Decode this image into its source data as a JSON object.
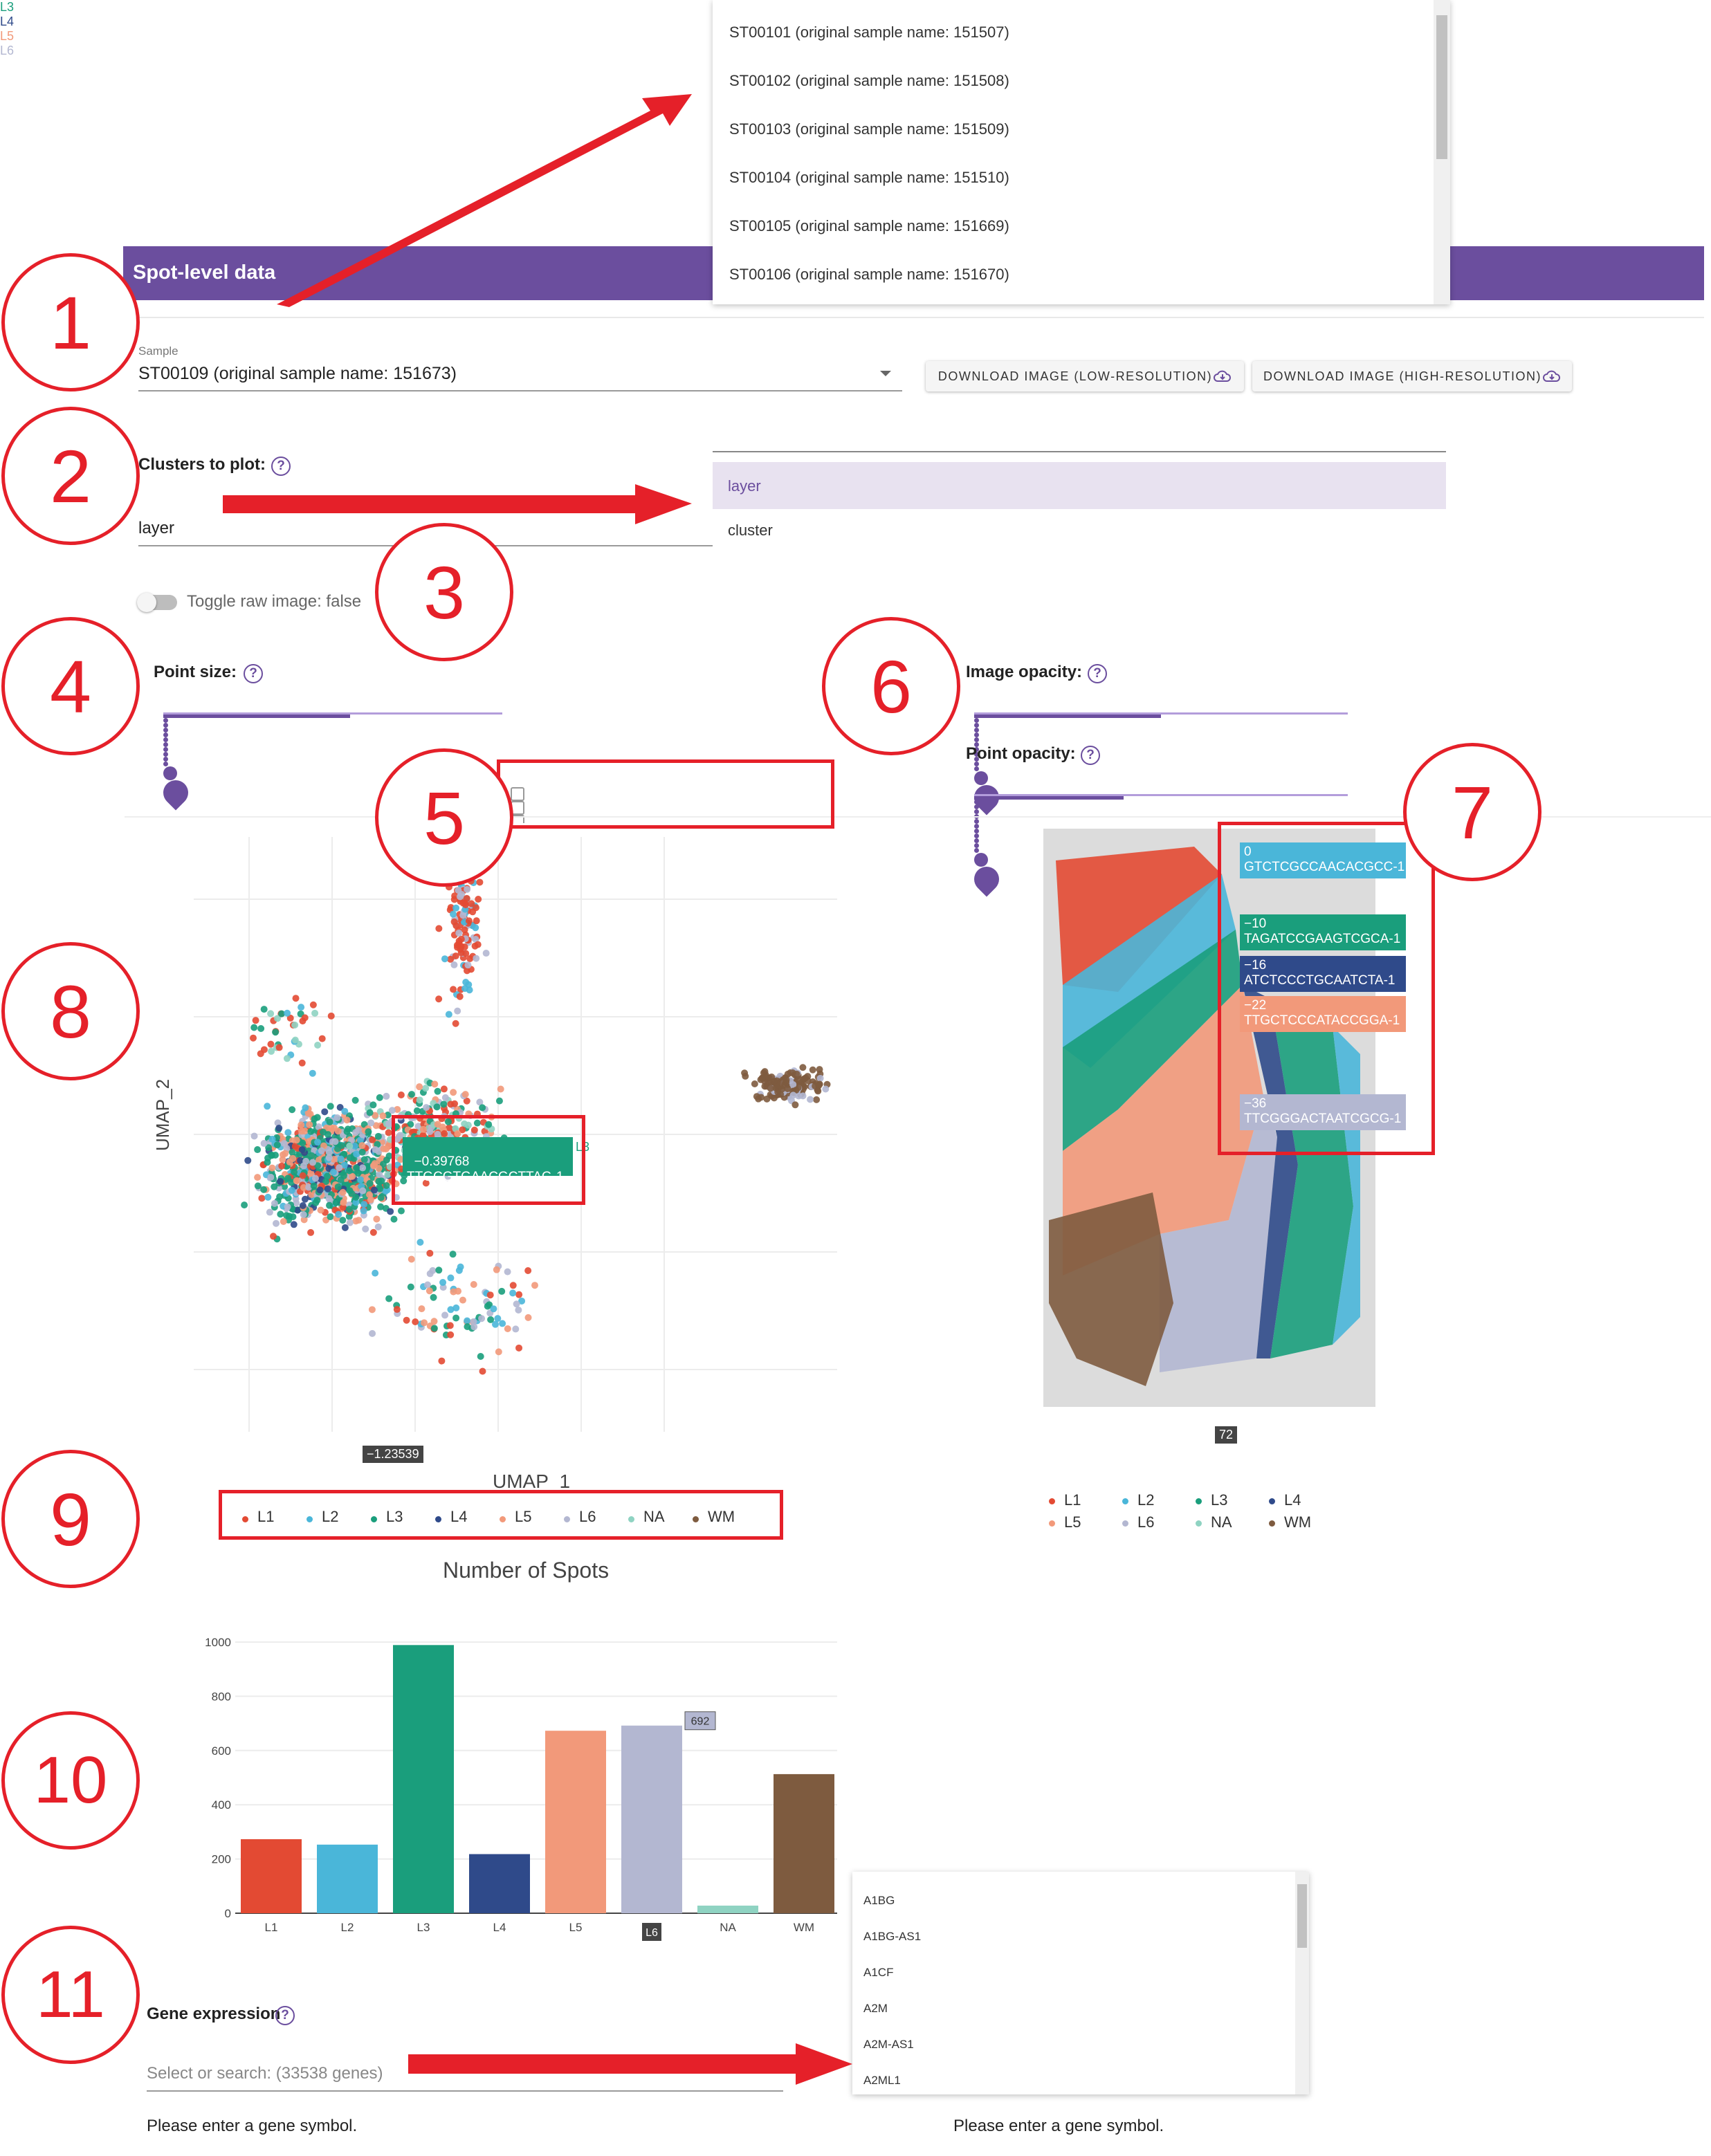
{
  "sample_dropdown": {
    "options": [
      "ST00101 (original sample name: 151507)",
      "ST00102 (original sample name: 151508)",
      "ST00103 (original sample name: 151509)",
      "ST00104 (original sample name: 151510)",
      "ST00105 (original sample name: 151669)",
      "ST00106 (original sample name: 151670)"
    ]
  },
  "header": {
    "title": "Spot-level data"
  },
  "sample": {
    "label": "Sample",
    "value": "ST00109 (original sample name: 151673)"
  },
  "buttons": {
    "download_low": "DOWNLOAD IMAGE (LOW-RESOLUTION)",
    "download_high": "DOWNLOAD IMAGE (HIGH-RESOLUTION)"
  },
  "clusters": {
    "label": "Clusters to plot:",
    "value": "layer",
    "options": [
      "layer",
      "cluster"
    ]
  },
  "toggle": {
    "label": "Toggle raw image: false"
  },
  "sliders": {
    "point_size": {
      "label": "Point size:",
      "value": 6,
      "fraction": 0.55
    },
    "image_opacity": {
      "label": "Image opacity:",
      "value": "0.5",
      "fraction": 0.5
    },
    "point_opacity": {
      "label": "Point opacity:",
      "value": "0.4",
      "fraction": 0.4
    }
  },
  "annotations": [
    "1",
    "2",
    "3",
    "4",
    "5",
    "6",
    "7",
    "8",
    "9",
    "10",
    "11"
  ],
  "umap": {
    "xlabel": "UMAP_1",
    "ylabel": "UMAP_2",
    "x_hover": "−1.23539",
    "tooltip": {
      "value": "−0.39768",
      "barcode": "TTGCGTGAACGCTTAG-1",
      "layer": "L3"
    }
  },
  "spatial": {
    "x_hover": "72",
    "tooltips": [
      {
        "value": "0",
        "barcode": "GTCTCGCCAACACGCC-1",
        "layer": "",
        "color": "#4ab6d9"
      },
      {
        "value": "−10",
        "barcode": "TAGATCCGAAGTCGCA-1",
        "layer": "L3",
        "color": "#1a9e7c"
      },
      {
        "value": "−16",
        "barcode": "ATCTCCCTGCAATCTA-1",
        "layer": "L4",
        "color": "#2f4a8a"
      },
      {
        "value": "−22",
        "barcode": "TTGCTCCCATACCGGA-1",
        "layer": "L5",
        "color": "#f2997a"
      },
      {
        "value": "−36",
        "barcode": "TTCGGGACTAATCGCG-1",
        "layer": "L6",
        "color": "#b3b7d1"
      }
    ]
  },
  "legend": [
    {
      "name": "L1",
      "color": "#e34a33"
    },
    {
      "name": "L2",
      "color": "#4ab6d9"
    },
    {
      "name": "L3",
      "color": "#1a9e7c"
    },
    {
      "name": "L4",
      "color": "#2f4a8a"
    },
    {
      "name": "L5",
      "color": "#f2997a"
    },
    {
      "name": "L6",
      "color": "#b3b7d1"
    },
    {
      "name": "NA",
      "color": "#8fd3c2"
    },
    {
      "name": "WM",
      "color": "#7e5b3f"
    }
  ],
  "chart_data": {
    "type": "bar",
    "title": "Number of Spots",
    "categories": [
      "L1",
      "L2",
      "L3",
      "L4",
      "L5",
      "L6",
      "NA",
      "WM"
    ],
    "values": [
      273,
      253,
      989,
      218,
      673,
      692,
      28,
      513
    ],
    "colors": [
      "#e34a33",
      "#4ab6d9",
      "#1a9e7c",
      "#2f4a8a",
      "#f2997a",
      "#b3b7d1",
      "#8fd3c2",
      "#7e5b3f"
    ],
    "ylim": [
      0,
      1000
    ],
    "yticks": [
      0,
      200,
      400,
      600,
      800,
      1000
    ],
    "hover_value": "692",
    "hover_category": "L6"
  },
  "gene": {
    "label": "Gene expression",
    "placeholder": "Select or search: (33538 genes)",
    "hint_left": "Please enter a gene symbol.",
    "hint_right": "Please enter a gene symbol.",
    "options": [
      "A1BG",
      "A1BG-AS1",
      "A1CF",
      "A2M",
      "A2M-AS1",
      "A2ML1"
    ]
  },
  "toolbar_icons": [
    "camera-icon",
    "zoom-icon",
    "pan-icon",
    "box-select-icon",
    "lasso-icon",
    "zoom-in-icon",
    "zoom-out-icon",
    "autoscale-icon",
    "reset-axes-icon",
    "spike-lines-icon",
    "hover-closest-icon",
    "hover-compare-icon",
    "plotly-logo-icon"
  ]
}
